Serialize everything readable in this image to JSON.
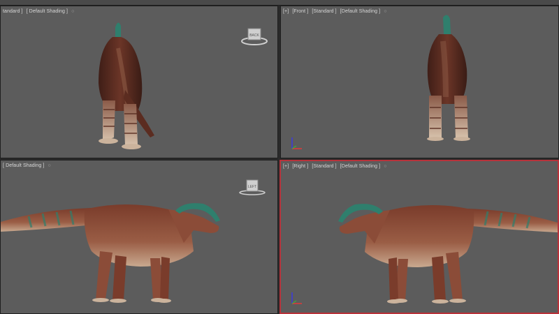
{
  "viewports": [
    {
      "id": "top-left",
      "labels": [
        "tandard ]",
        "[ Default Shading ]"
      ],
      "menu_icon": "circle-icon",
      "gizmo": "viewcube-icon",
      "gizmo_label": "BACK"
    },
    {
      "id": "top-right",
      "labels": [
        "[+]",
        "[Front ]",
        "[Standard ]",
        "[Default Shading ]"
      ],
      "menu_icon": "circle-icon",
      "axis": "xyz-axis-icon"
    },
    {
      "id": "bottom-left",
      "labels": [
        "[ Default Shading ]"
      ],
      "menu_icon": "circle-icon",
      "gizmo": "viewcube-icon",
      "gizmo_label": "LEFT"
    },
    {
      "id": "bottom-right",
      "labels": [
        "[+]",
        "[Right ]",
        "[Standard ]",
        "[Default Shading ]"
      ],
      "menu_icon": "circle-icon",
      "axis": "xyz-axis-icon",
      "active": true
    }
  ],
  "colors": {
    "viewport_bg": "#5c5c5c",
    "active_border": "#b8323a",
    "crest": "#2f7f6d",
    "skin_dark": "#5a2e22",
    "skin_mid": "#8b4c38",
    "belly": "#c9a98f"
  }
}
